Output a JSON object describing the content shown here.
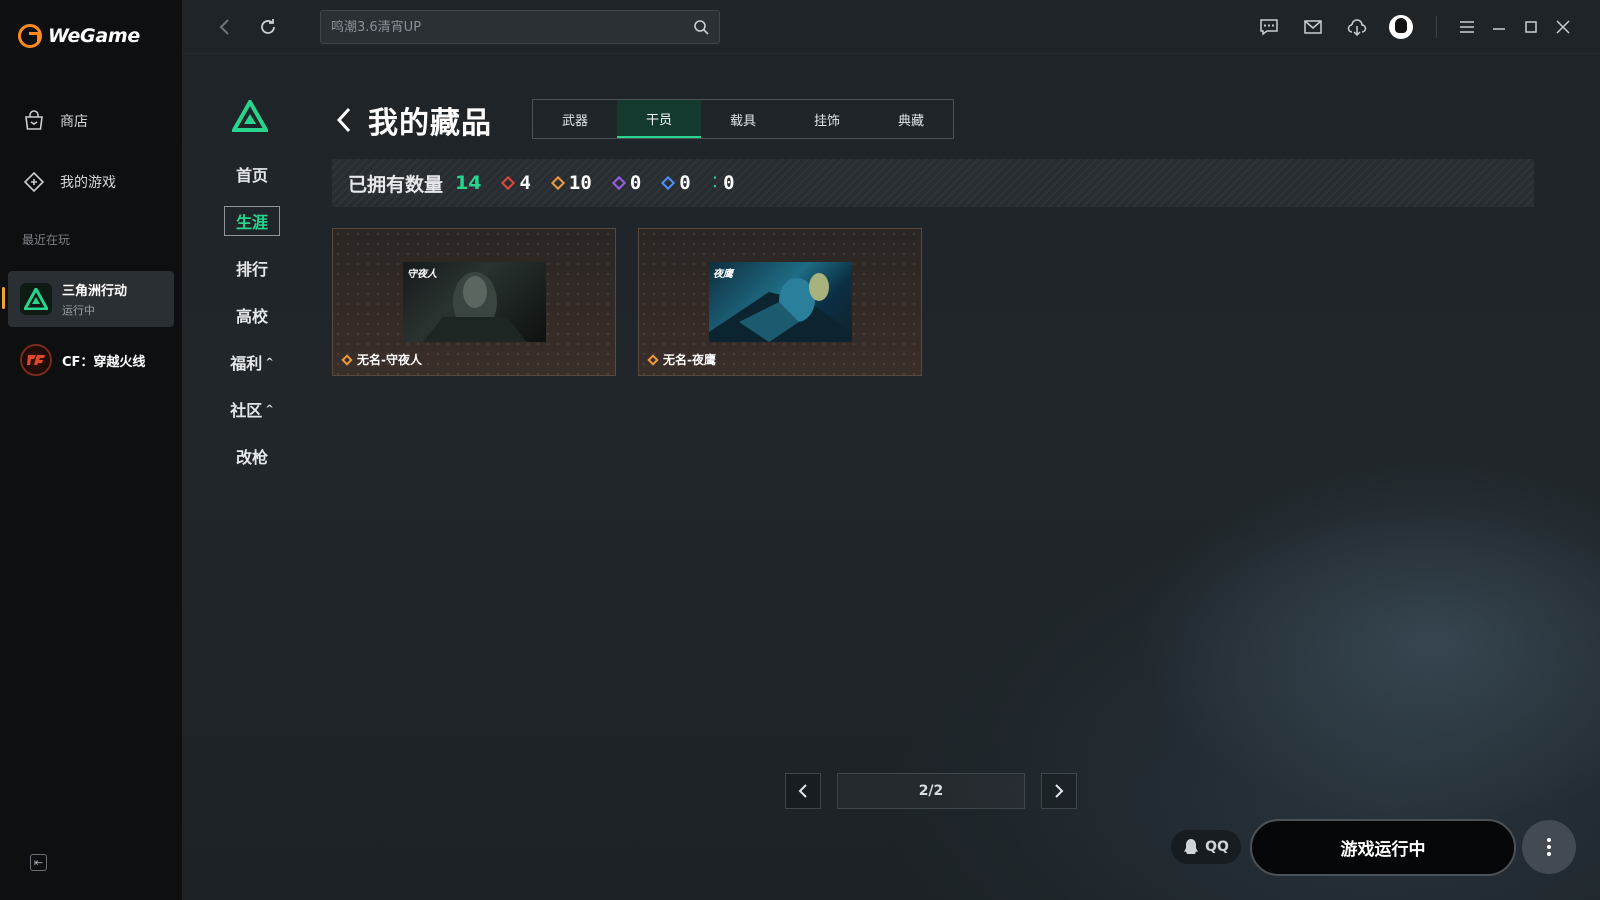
{
  "app": {
    "name": "WeGame"
  },
  "sidebar": {
    "nav": [
      {
        "label": "商店",
        "icon": "shop-bag-icon"
      },
      {
        "label": "我的游戏",
        "icon": "game-controller-icon"
      }
    ],
    "recent_title": "最近在玩",
    "recent_games": [
      {
        "name": "三角洲行动",
        "status": "运行中",
        "active": true
      },
      {
        "name": "CF：穿越火线",
        "status": ""
      }
    ]
  },
  "search": {
    "placeholder": "鸣潮3.6清宵UP"
  },
  "game_nav": {
    "items": [
      {
        "label": "首页"
      },
      {
        "label": "生涯",
        "active": true
      },
      {
        "label": "排行"
      },
      {
        "label": "高校"
      },
      {
        "label": "福利",
        "caret": "^"
      },
      {
        "label": "社区",
        "caret": "^"
      },
      {
        "label": "改枪"
      }
    ]
  },
  "page": {
    "title": "我的藏品",
    "tabs": [
      {
        "label": "武器"
      },
      {
        "label": "干员",
        "active": true
      },
      {
        "label": "载具"
      },
      {
        "label": "挂饰"
      },
      {
        "label": "典藏"
      }
    ]
  },
  "stats": {
    "label": "已拥有数量",
    "total": "14",
    "items": [
      {
        "value": "4",
        "color": "#e0463c"
      },
      {
        "value": "10",
        "color": "#f09a3e"
      },
      {
        "value": "0",
        "color": "#9b5de5"
      },
      {
        "value": "0",
        "color": "#4f8ff7"
      },
      {
        "value": "0",
        "color": "#27d58d"
      }
    ]
  },
  "cards": [
    {
      "name": "无名-守夜人",
      "image_tag": "守夜人",
      "rarity_color": "#f09a3e"
    },
    {
      "name": "无名-夜鹰",
      "image_tag": "夜鹰",
      "rarity_color": "#f09a3e"
    }
  ],
  "pagination": {
    "label": "2/2",
    "current": 2,
    "total": 2
  },
  "bottom": {
    "qq_label": "QQ",
    "run_label": "游戏运行中"
  },
  "colors": {
    "accent_green": "#27d58d",
    "brand_orange": "#ff8a1f"
  }
}
